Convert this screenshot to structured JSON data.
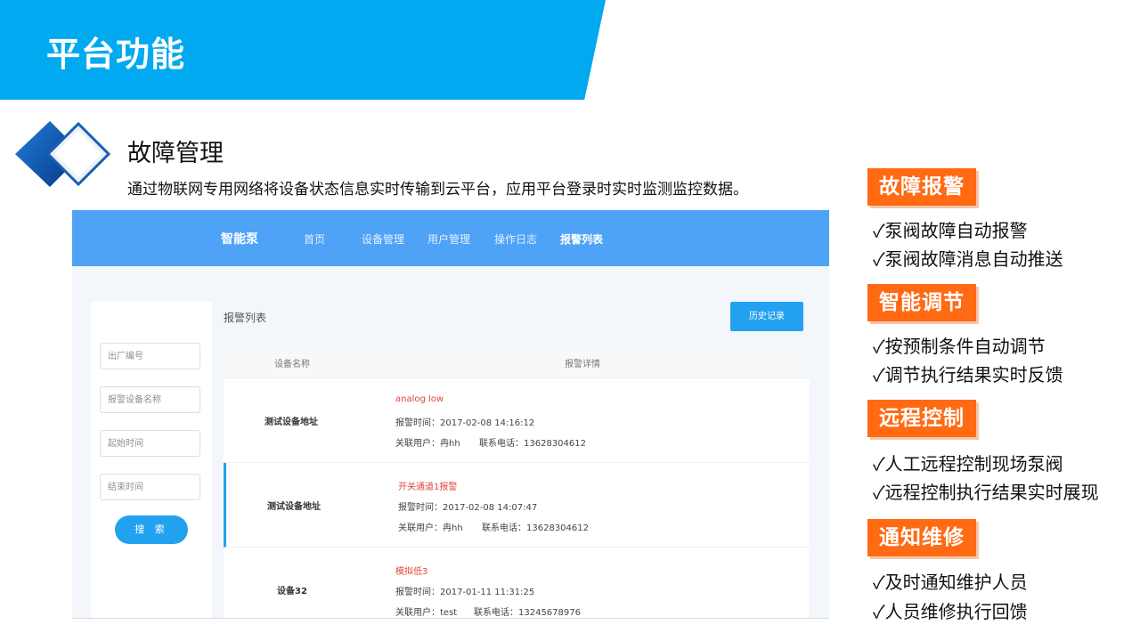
{
  "banner": {
    "title": "平台功能"
  },
  "section": {
    "title": "故障管理",
    "description": "通过物联网专用网络将设备状态信息实时传输到云平台，应用平台登录时实时监测监控数据。"
  },
  "app": {
    "brand": "智能泵",
    "nav": [
      "首页",
      "设备管理",
      "用户管理",
      "操作日志",
      "报警列表"
    ],
    "active_nav": "报警列表",
    "filters": {
      "factory_no_placeholder": "出厂编号",
      "device_name_placeholder": "报警设备名称",
      "start_time_placeholder": "起始时间",
      "end_time_placeholder": "结束时间",
      "search_label": "搜 索"
    },
    "list_title": "报警列表",
    "history_label": "历史记录",
    "columns": [
      "设备名称",
      "报警详情"
    ],
    "rows": [
      {
        "device": "测试设备地址",
        "alarm": "analog low",
        "time": "报警时间：2017-02-08 14:16:12",
        "user": "关联用户：冉hh",
        "phone": "联系电话：13628304612"
      },
      {
        "device": "测试设备地址",
        "alarm": "开关通道1报警",
        "time": "报警时间：2017-02-08 14:07:47",
        "user": "关联用户：冉hh",
        "phone": "联系电话：13628304612"
      },
      {
        "device": "设备32",
        "alarm": "模拟低3",
        "time": "报警时间：2017-01-11 11:31:25",
        "user": "关联用户：test",
        "phone": "联系电话：13245678976"
      }
    ]
  },
  "features": [
    {
      "tag": "故障报警",
      "items": [
        "✓泵阀故障自动报警",
        "✓泵阀故障消息自动推送"
      ]
    },
    {
      "tag": "智能调节",
      "items": [
        "✓按预制条件自动调节",
        "✓调节执行结果实时反馈"
      ]
    },
    {
      "tag": "远程控制",
      "items": [
        "✓人工远程控制现场泵阀",
        "✓远程控制执行结果实时展现"
      ]
    },
    {
      "tag": "通知维修",
      "items": [
        "✓及时通知维护人员",
        "✓人员维修执行回馈"
      ]
    }
  ],
  "colors": {
    "banner": "#00a9f0",
    "app_nav": "#4fa3f7",
    "primary_button": "#22a1ef",
    "alarm_text": "#e0463a",
    "feature_tag": "#ff6a13"
  }
}
